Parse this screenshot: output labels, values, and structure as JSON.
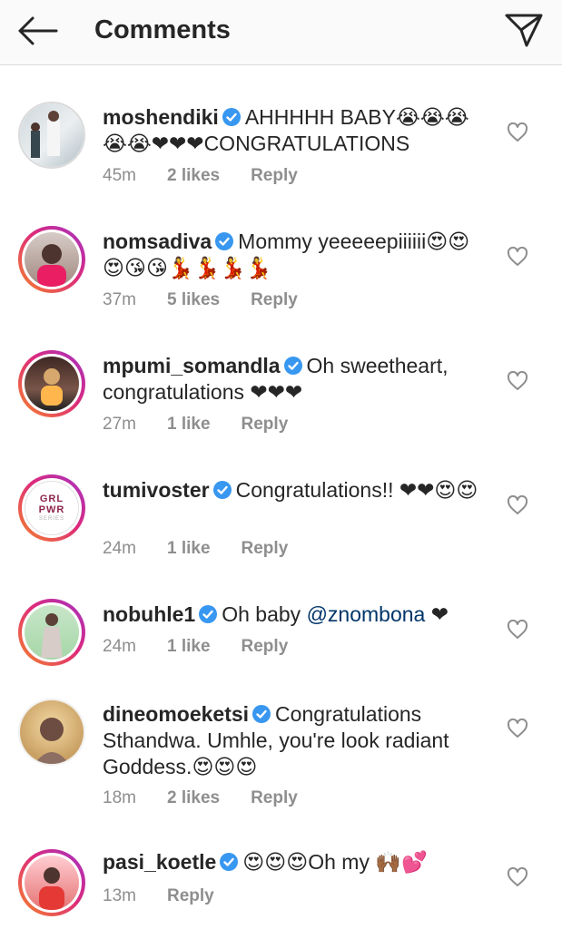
{
  "header": {
    "title": "Comments",
    "back_icon": "arrow-left-icon",
    "send_icon": "paper-plane-icon"
  },
  "comments": [
    {
      "username": "moshendiki",
      "text": "AHHHHH BABY😭😭😭😭😭❤❤❤CONGRATULATIONS",
      "time": "45m",
      "likes": "2 likes",
      "reply": "Reply"
    },
    {
      "username": "nomsadiva",
      "text": "Mommy yeeeeepiiiiii😍😍😍😘😘💃💃💃💃",
      "time": "37m",
      "likes": "5 likes",
      "reply": "Reply"
    },
    {
      "username": "mpumi_somandla",
      "text": "Oh sweetheart, congratulations ❤❤❤",
      "time": "27m",
      "likes": "1 like",
      "reply": "Reply"
    },
    {
      "username": "tumivoster",
      "text": "Congratulations!! ❤❤😍😍",
      "time": "24m",
      "likes": "1 like",
      "reply": "Reply"
    },
    {
      "username": "nobuhle1",
      "text_before": "Oh baby ",
      "mention": "@znombona",
      "text_after": " ❤",
      "time": "24m",
      "likes": "1 like",
      "reply": "Reply"
    },
    {
      "username": "dineomoeketsi",
      "text": "Congratulations Sthandwa. Umhle, you're look radiant Goddess.😍😍😍",
      "time": "18m",
      "likes": "2 likes",
      "reply": "Reply"
    },
    {
      "username": "pasi_koetle",
      "text": "😍😍😍Oh my 🙌🏾💕",
      "time": "13m",
      "reply": "Reply"
    }
  ],
  "avatar_logo": {
    "line1": "GRL",
    "line2": "PWR",
    "line3": "SERIES"
  },
  "colors": {
    "verified": "#3897f0",
    "mention": "#003569",
    "meta": "#8e8e8e",
    "header_bg": "#fafafa"
  }
}
